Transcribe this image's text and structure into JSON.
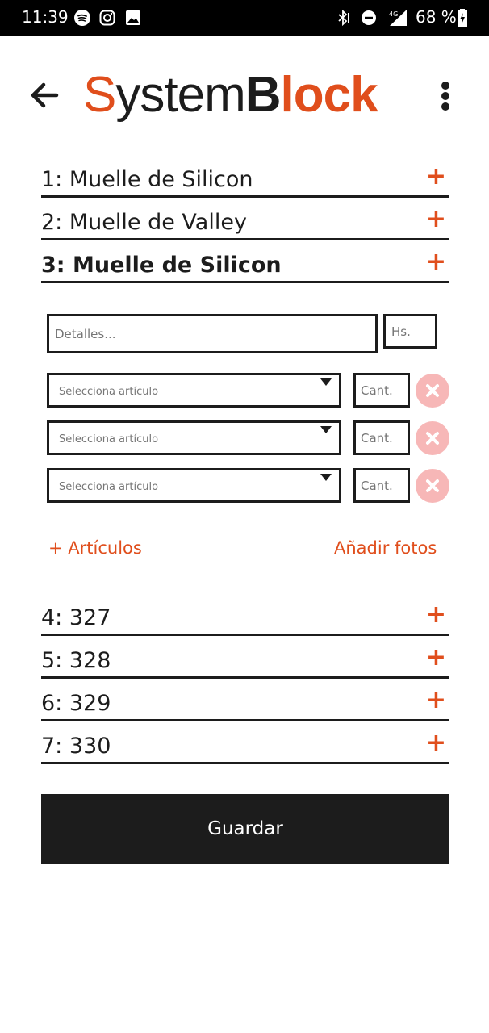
{
  "status_bar": {
    "time": "11:39",
    "network": "4G",
    "battery": "68 %"
  },
  "header": {
    "logo_part1": "S",
    "logo_part2": "ystem",
    "logo_part3": "B",
    "logo_part4": "lock",
    "back_icon": "arrow-left-icon",
    "menu_icon": "more-vert-icon"
  },
  "sections": [
    {
      "label": "1: Muelle de Silicon"
    },
    {
      "label": "2: Muelle de Valley"
    },
    {
      "label": "3: Muelle de Silicon"
    },
    {
      "label": "4: 327"
    },
    {
      "label": "5: 328"
    },
    {
      "label": "6: 329"
    },
    {
      "label": "7: 330"
    }
  ],
  "plus_symbol": "+",
  "form": {
    "details_placeholder": "Detalles...",
    "hours_placeholder": "Hs.",
    "items": [
      {
        "select_placeholder": "Selecciona artículo",
        "qty_placeholder": "Cant."
      },
      {
        "select_placeholder": "Selecciona artículo",
        "qty_placeholder": "Cant."
      },
      {
        "select_placeholder": "Selecciona artículo",
        "qty_placeholder": "Cant."
      }
    ],
    "add_items_label": "+ Artículos",
    "add_photos_label": "Añadir fotos"
  },
  "save_label": "Guardar",
  "colors": {
    "accent": "#e04e1c",
    "dark": "#1c1c1c",
    "remove_bg": "#f7b7b7"
  }
}
